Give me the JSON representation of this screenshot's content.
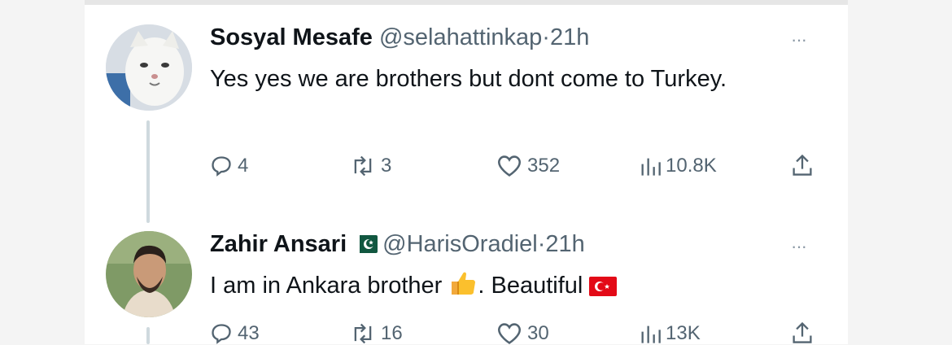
{
  "tweets": [
    {
      "name": "Sosyal Mesafe",
      "handle": "@selahattinkap",
      "separator": "·",
      "time": "21h",
      "text": "Yes yes we are brothers but dont come to Turkey.",
      "more": "···",
      "stats": {
        "replies": "4",
        "retweets": "3",
        "likes": "352",
        "views": "10.8K"
      },
      "avatar": "cat-avatar"
    },
    {
      "name": "Zahir Ansari",
      "handle": "@HarisOradiel",
      "separator": "·",
      "time": "21h",
      "text_before": "I am in Ankara brother",
      "text_after": ". Beautiful",
      "more": "···",
      "stats": {
        "replies": "43",
        "retweets": "16",
        "likes": "30",
        "views": "13K"
      },
      "avatar": "man-avatar",
      "name_flag": "pakistan-flag",
      "emojis": [
        "thumbs-up-emoji",
        "turkey-flag"
      ]
    }
  ],
  "colors": {
    "text": "#0f1419",
    "secondary": "#536471",
    "thread": "#cfd9de"
  }
}
